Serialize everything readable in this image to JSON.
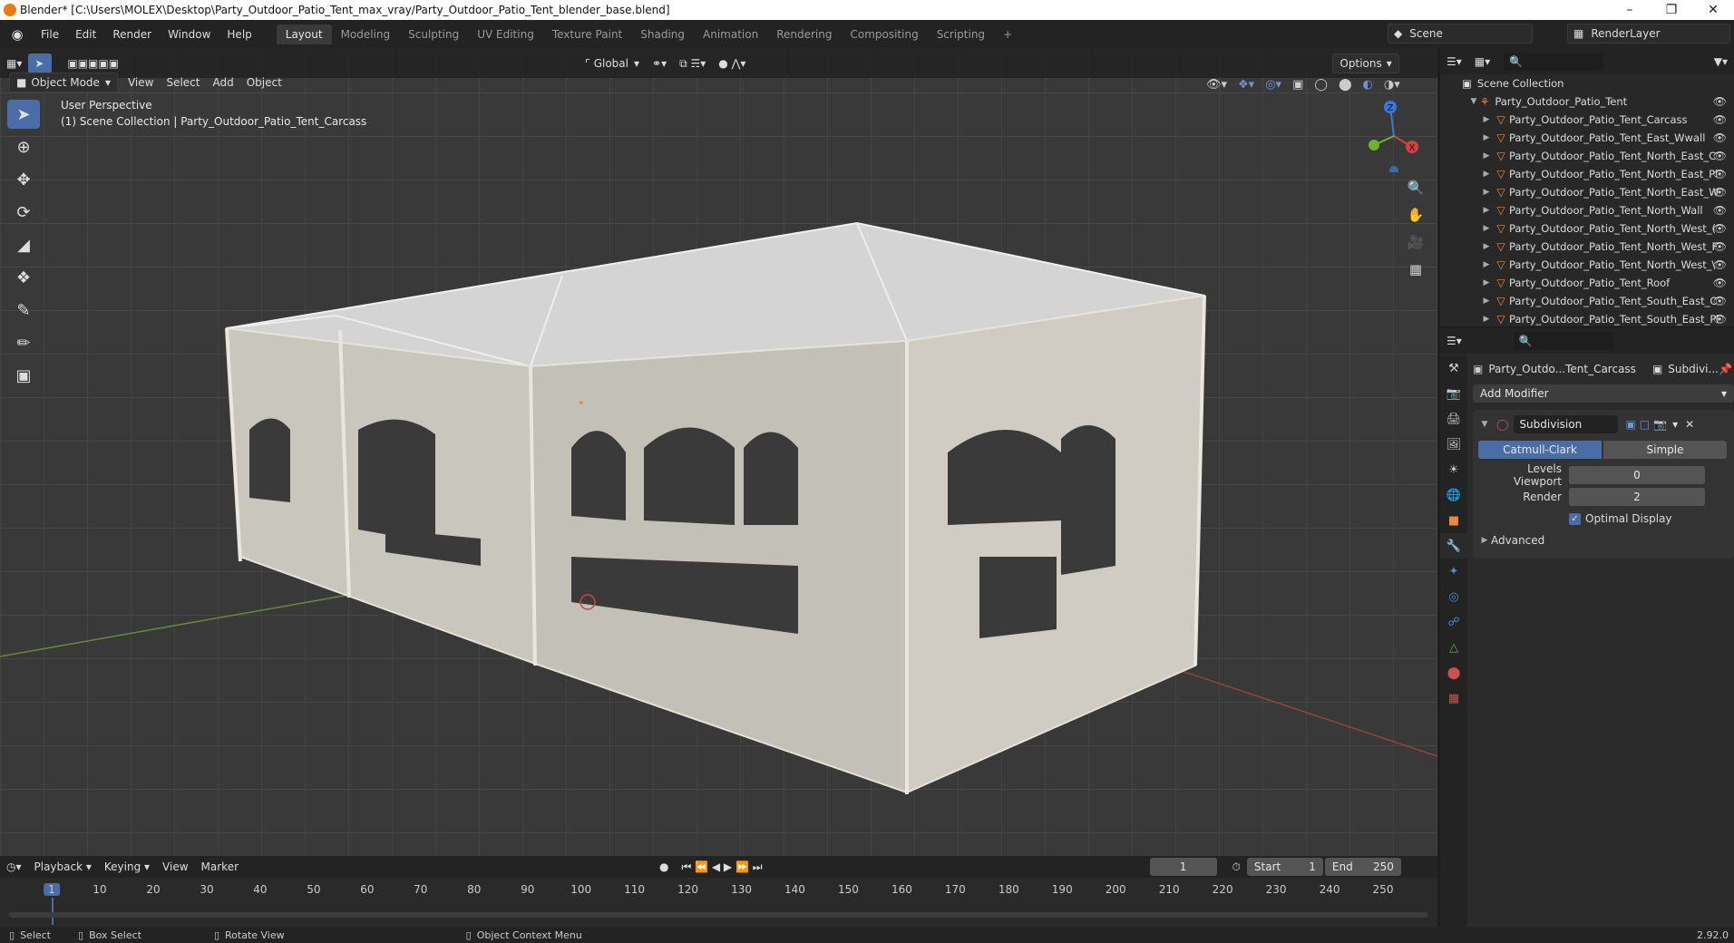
{
  "titlebar": {
    "title": "Blender* [C:\\Users\\MOLEX\\Desktop\\Party_Outdoor_Patio_Tent_max_vray/Party_Outdoor_Patio_Tent_blender_base.blend]"
  },
  "menus": [
    "File",
    "Edit",
    "Render",
    "Window",
    "Help"
  ],
  "workspaces": [
    "Layout",
    "Modeling",
    "Sculpting",
    "UV Editing",
    "Texture Paint",
    "Shading",
    "Animation",
    "Rendering",
    "Compositing",
    "Scripting"
  ],
  "scene": {
    "name": "Scene",
    "render_layer": "RenderLayer"
  },
  "viewport": {
    "transform_orientation": "Global",
    "options_label": "Options",
    "mode": "Object Mode",
    "menu": [
      "View",
      "Select",
      "Add",
      "Object"
    ],
    "perspective": "User Perspective",
    "collection_info": "(1) Scene Collection | Party_Outdoor_Patio_Tent_Carcass",
    "gizmo_axes": [
      "Z",
      "Y",
      "X"
    ]
  },
  "outliner": {
    "root": "Scene Collection",
    "collection": "Party_Outdoor_Patio_Tent",
    "items": [
      "Party_Outdoor_Patio_Tent_Carcass",
      "Party_Outdoor_Patio_Tent_East_Wwall",
      "Party_Outdoor_Patio_Tent_North_East_C",
      "Party_Outdoor_Patio_Tent_North_East_Pl",
      "Party_Outdoor_Patio_Tent_North_East_W",
      "Party_Outdoor_Patio_Tent_North_Wall",
      "Party_Outdoor_Patio_Tent_North_West_(",
      "Party_Outdoor_Patio_Tent_North_West_F",
      "Party_Outdoor_Patio_Tent_North_West_\\",
      "Party_Outdoor_Patio_Tent_Roof",
      "Party_Outdoor_Patio_Tent_South_East_C",
      "Party_Outdoor_Patio_Tent_South_East_Pl"
    ]
  },
  "properties": {
    "object_name": "Party_Outdo...Tent_Carcass",
    "modifier_short": "Subdivi...",
    "add_modifier": "Add Modifier",
    "modifier_name": "Subdivision",
    "mode_a": "Catmull-Clark",
    "mode_b": "Simple",
    "levels_viewport_label": "Levels Viewport",
    "levels_viewport": "0",
    "render_label": "Render",
    "render_value": "2",
    "optimal_display": "Optimal Display",
    "advanced": "Advanced"
  },
  "timeline": {
    "menu": [
      "Playback",
      "Keying",
      "View",
      "Marker"
    ],
    "current_frame": "1",
    "start_label": "Start",
    "start": "1",
    "end_label": "End",
    "end": "250",
    "ticks": [
      "1",
      "10",
      "20",
      "30",
      "40",
      "50",
      "60",
      "70",
      "80",
      "90",
      "100",
      "110",
      "120",
      "130",
      "140",
      "150",
      "160",
      "170",
      "180",
      "190",
      "200",
      "210",
      "220",
      "230",
      "240",
      "250"
    ]
  },
  "status": {
    "select": "Select",
    "box_select": "Box Select",
    "rotate_view": "Rotate View",
    "context_menu": "Object Context Menu",
    "version": "2.92.0"
  }
}
